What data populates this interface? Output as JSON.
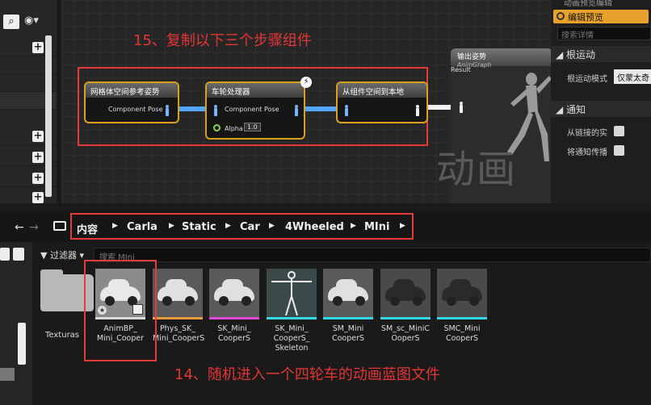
{
  "left_top": {
    "search_icon": "magnifier",
    "eye_icon": "eye"
  },
  "graph": {
    "annotation": "15、复制以下三个步骤组件",
    "watermark": "动画",
    "nodes": [
      {
        "title": "网格体空间参考姿势",
        "pin": "Component Pose"
      },
      {
        "title": "车轮处理器",
        "pin": "Component Pose",
        "alpha_label": "Alpha",
        "alpha_value": "1.0"
      },
      {
        "title": "从组件空间到本地",
        "pin": ""
      }
    ],
    "output_node": {
      "title": "输出姿势",
      "subtitle": "AnimGraph",
      "pin": "Result"
    }
  },
  "details": {
    "tab_label": "编辑预览",
    "top_cut_text": "动画预览编辑",
    "search_placeholder": "搜索详情",
    "section_root_motion": "根运动",
    "root_motion_label": "根运动模式",
    "root_motion_value": "仅蒙太奇",
    "section_notify": "通知",
    "notify_label_1": "从链接的实",
    "notify_label_2": "将通知传播"
  },
  "breadcrumb": {
    "items": [
      "内容",
      "Carla",
      "Static",
      "Car",
      "4Wheeled",
      "MIni"
    ]
  },
  "filter": {
    "label": "过滤器",
    "search_placeholder": "搜索 MIni"
  },
  "folder": {
    "label": "Texturas"
  },
  "assets": [
    {
      "name": "AnimBP_\nMini_Cooper",
      "bar_color": "#d9d9d9",
      "kind": "anim"
    },
    {
      "name": "Phys_SK_\nMini_CooperS",
      "bar_color": "#e59a3b",
      "kind": "car"
    },
    {
      "name": "SK_Mini_\nCooperS",
      "bar_color": "#e24bd6",
      "kind": "car"
    },
    {
      "name": "SK_Mini_\nCooperS_\nSkeleton",
      "bar_color": "#33d8e6",
      "kind": "skeleton"
    },
    {
      "name": "SM_Mini\nCooperS",
      "bar_color": "#33d8e6",
      "kind": "car"
    },
    {
      "name": "SM_sc_MiniC\nOoperS",
      "bar_color": "#33d8e6",
      "kind": "dark"
    },
    {
      "name": "SMC_Mini\nCooperS",
      "bar_color": "#33d8e6",
      "kind": "dark"
    }
  ],
  "annotation_14": "14、随机进入一个四轮车的动画蓝图文件"
}
